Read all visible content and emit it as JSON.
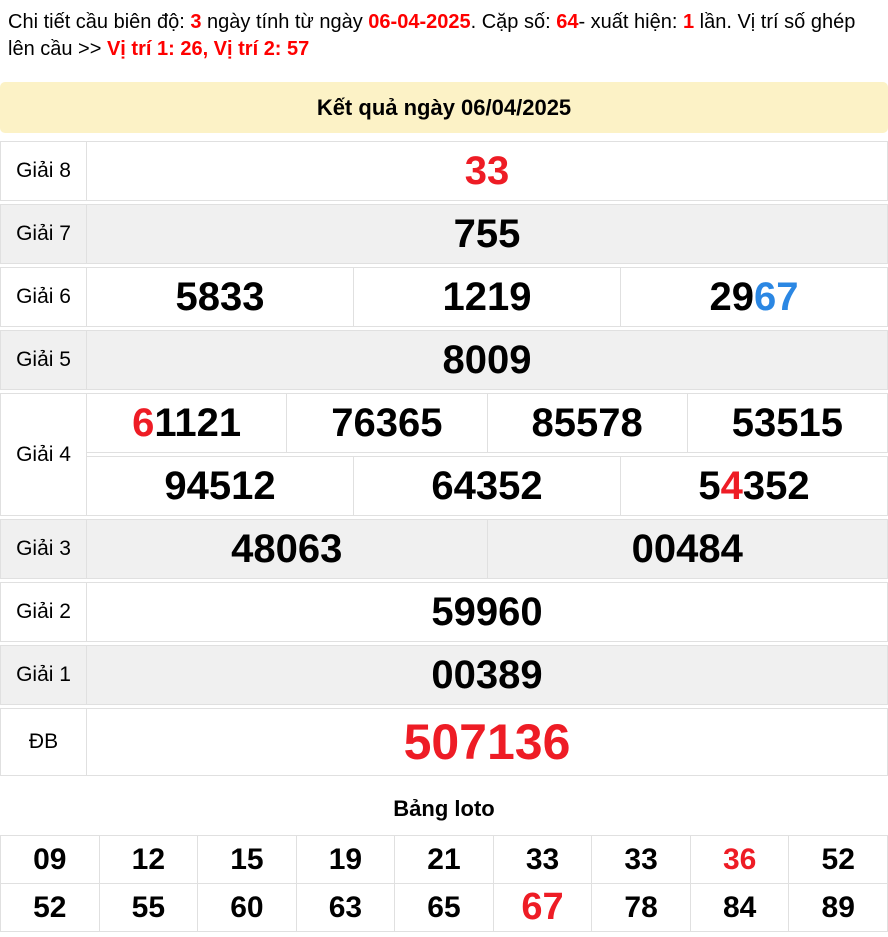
{
  "colors": {
    "number_red": "#ee1c25",
    "header_red": "#fe0000",
    "highlight_blue": "#2b87e3",
    "banner_bg": "#fcf2c6",
    "shaded_row_bg": "#f0f0f0",
    "border": "#e0e0e0",
    "text": "#000000"
  },
  "header": {
    "segments": [
      {
        "text": "Chi tiết cầu biên độ: ",
        "style": "black"
      },
      {
        "text": "3",
        "style": "red"
      },
      {
        "text": " ngày tính từ ngày ",
        "style": "black"
      },
      {
        "text": "06-04-2025",
        "style": "red"
      },
      {
        "text": ". Cặp số: ",
        "style": "black"
      },
      {
        "text": "64",
        "style": "red"
      },
      {
        "text": "- xuất hiện: ",
        "style": "black"
      },
      {
        "text": "1",
        "style": "red"
      },
      {
        "text": " lần. Vị trí số ghép lên cầu >> ",
        "style": "black"
      },
      {
        "text": "Vị trí 1: 26, Vị trí 2: 57",
        "style": "red"
      }
    ]
  },
  "result_title": "Kết quả ngày 06/04/2025",
  "prizes": [
    {
      "label": "Giải 8",
      "rows": [
        [
          [
            {
              "t": "33",
              "c": "red"
            }
          ]
        ]
      ]
    },
    {
      "label": "Giải 7",
      "rows": [
        [
          [
            {
              "t": "755"
            }
          ]
        ]
      ]
    },
    {
      "label": "Giải 6",
      "rows": [
        [
          [
            {
              "t": "5833"
            }
          ],
          [
            {
              "t": "1219"
            }
          ],
          [
            {
              "t": "29"
            },
            {
              "t": "67",
              "c": "blue"
            }
          ]
        ]
      ]
    },
    {
      "label": "Giải 5",
      "rows": [
        [
          [
            {
              "t": "8009"
            }
          ]
        ]
      ]
    },
    {
      "label": "Giải 4",
      "rows": [
        [
          [
            {
              "t": "6",
              "c": "red"
            },
            {
              "t": "1121"
            }
          ],
          [
            {
              "t": "76365"
            }
          ],
          [
            {
              "t": "85578"
            }
          ],
          [
            {
              "t": "53515"
            }
          ]
        ],
        [
          [
            {
              "t": "94512"
            }
          ],
          [
            {
              "t": "64352"
            }
          ],
          [
            {
              "t": "5"
            },
            {
              "t": "4",
              "c": "red"
            },
            {
              "t": "352"
            }
          ]
        ]
      ]
    },
    {
      "label": "Giải 3",
      "rows": [
        [
          [
            {
              "t": "48063"
            }
          ],
          [
            {
              "t": "00484"
            }
          ]
        ]
      ]
    },
    {
      "label": "Giải 2",
      "rows": [
        [
          [
            {
              "t": "59960"
            }
          ]
        ]
      ]
    },
    {
      "label": "Giải 1",
      "rows": [
        [
          [
            {
              "t": "00389"
            }
          ]
        ]
      ]
    },
    {
      "label": "ĐB",
      "size": "xl",
      "rows": [
        [
          [
            {
              "t": "507136",
              "c": "red"
            }
          ]
        ]
      ]
    }
  ],
  "loto": {
    "title": "Bảng loto",
    "rows": [
      [
        {
          "t": "09"
        },
        {
          "t": "12"
        },
        {
          "t": "15"
        },
        {
          "t": "19"
        },
        {
          "t": "21"
        },
        {
          "t": "33"
        },
        {
          "t": "33"
        },
        {
          "t": "36",
          "c": "red"
        },
        {
          "t": "52"
        }
      ],
      [
        {
          "t": "52"
        },
        {
          "t": "55"
        },
        {
          "t": "60"
        },
        {
          "t": "63"
        },
        {
          "t": "65"
        },
        {
          "t": "67",
          "c": "red",
          "big": true
        },
        {
          "t": "78"
        },
        {
          "t": "84"
        },
        {
          "t": "89"
        }
      ]
    ]
  }
}
